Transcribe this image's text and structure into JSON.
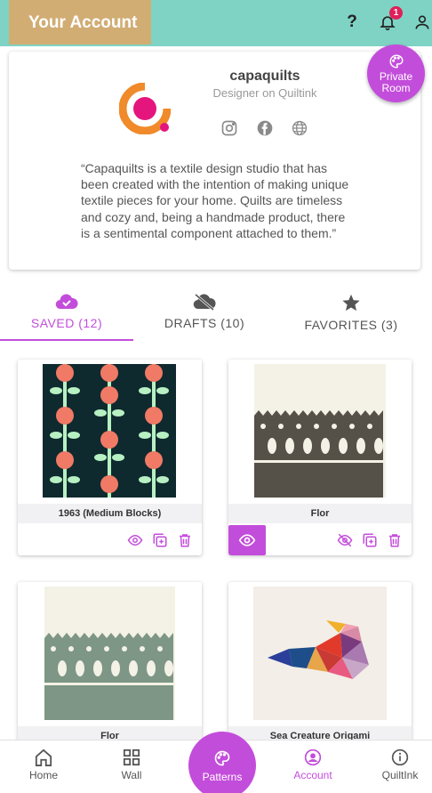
{
  "header": {
    "title": "Your Account",
    "notification_count": "1"
  },
  "profile": {
    "username": "capaquilts",
    "tagline": "Designer on Quiltink",
    "bio": "“Capaquilts is a textile design studio that has been created with the intention of making unique textile pieces for your home. Quilts are timeless and cozy and, being a handmade product, there is a sentimental component attached to them.”",
    "private_room_label": "Private Room"
  },
  "tabs": [
    {
      "label": "SAVED (12)",
      "active": true
    },
    {
      "label": "DRAFTS (10)",
      "active": false
    },
    {
      "label": "FAVORITES (3)",
      "active": false
    }
  ],
  "patterns": [
    {
      "title": "1963 (Medium Blocks)"
    },
    {
      "title": "Flor"
    },
    {
      "title": "Flor"
    },
    {
      "title": "Sea Creature Origami"
    }
  ],
  "nav": {
    "home": "Home",
    "wall": "Wall",
    "patterns": "Patterns",
    "account": "Account",
    "quiltink": "QuiltInk"
  },
  "colors": {
    "accent": "#c34ddb",
    "topbar": "#7fd3c5",
    "title_bg": "#d1ad74"
  }
}
